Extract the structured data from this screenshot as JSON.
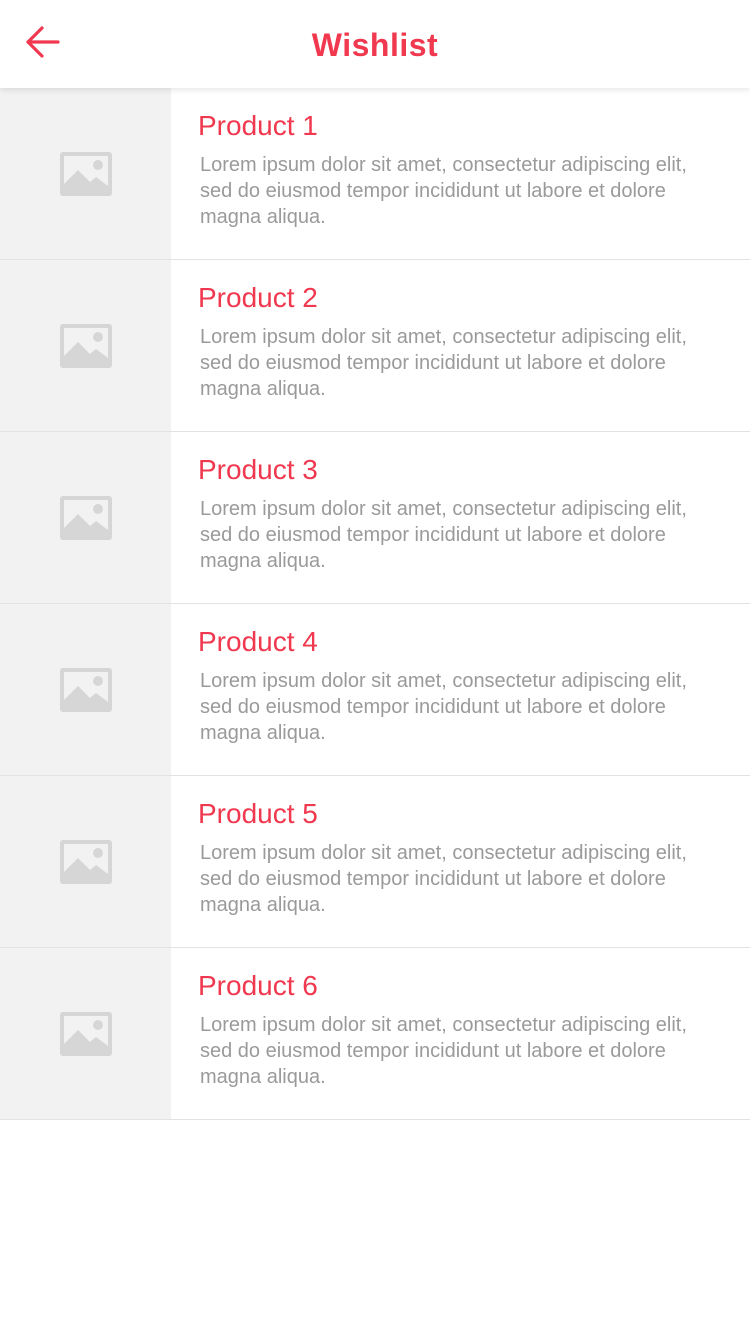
{
  "colors": {
    "accent": "#f0384f",
    "placeholder_bg": "#f2f2f2",
    "placeholder_icon": "#d6d6d6",
    "description_text": "#9a9a9a",
    "divider": "#e2e2e2"
  },
  "header": {
    "title": "Wishlist",
    "back_icon": "arrow-left-icon"
  },
  "products": [
    {
      "name": "Product 1",
      "description": "Lorem ipsum dolor sit amet, consectetur adipiscing elit, sed do eiusmod tempor incididunt ut labore et dolore magna aliqua.",
      "image_icon": "image-placeholder-icon"
    },
    {
      "name": "Product 2",
      "description": "Lorem ipsum dolor sit amet, consectetur adipiscing elit, sed do eiusmod tempor incididunt ut labore et dolore magna aliqua.",
      "image_icon": "image-placeholder-icon"
    },
    {
      "name": "Product 3",
      "description": "Lorem ipsum dolor sit amet, consectetur adipiscing elit, sed do eiusmod tempor incididunt ut labore et dolore magna aliqua.",
      "image_icon": "image-placeholder-icon"
    },
    {
      "name": "Product 4",
      "description": "Lorem ipsum dolor sit amet, consectetur adipiscing elit, sed do eiusmod tempor incididunt ut labore et dolore magna aliqua.",
      "image_icon": "image-placeholder-icon"
    },
    {
      "name": "Product 5",
      "description": "Lorem ipsum dolor sit amet, consectetur adipiscing elit, sed do eiusmod tempor incididunt ut labore et dolore magna aliqua.",
      "image_icon": "image-placeholder-icon"
    },
    {
      "name": "Product 6",
      "description": "Lorem ipsum dolor sit amet, consectetur adipiscing elit, sed do eiusmod tempor incididunt ut labore et dolore magna aliqua.",
      "image_icon": "image-placeholder-icon"
    }
  ]
}
